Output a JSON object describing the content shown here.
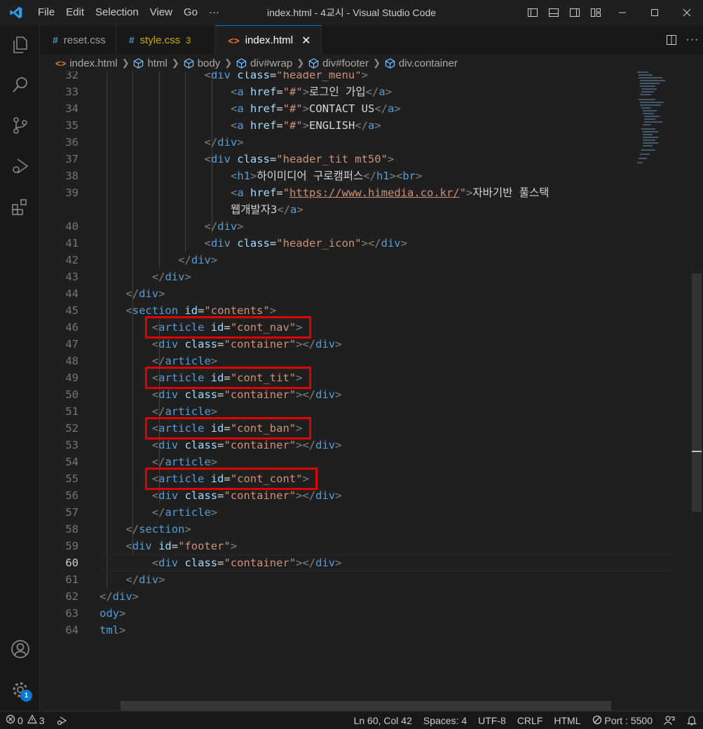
{
  "window": {
    "title": "index.html - 4교시 - Visual Studio Code",
    "menus": [
      "File",
      "Edit",
      "Selection",
      "View",
      "Go",
      "···"
    ]
  },
  "activity_bar": [
    "explorer-icon",
    "search-icon",
    "source-control-icon",
    "run-debug-icon",
    "extensions-icon",
    "account-icon",
    "settings-gear-icon"
  ],
  "settings_badge": "1",
  "tabs": [
    {
      "label": "reset.css",
      "icon": "#",
      "color": "#519aba",
      "active": false
    },
    {
      "label": "style.css",
      "icon": "#",
      "color": "#cca700",
      "modified_count": "3",
      "active": false
    },
    {
      "label": "index.html",
      "icon": "<>",
      "color": "#e37933",
      "active": true,
      "close": "✕"
    }
  ],
  "breadcrumb": [
    "index.html",
    "html",
    "body",
    "div#wrap",
    "div#footer",
    "div.container"
  ],
  "editor": {
    "current_line": 60,
    "lines": [
      {
        "n": "32",
        "indent": 4,
        "parts": [
          [
            "tg",
            "<"
          ],
          [
            "tn",
            "div "
          ],
          [
            "an",
            "class"
          ],
          [
            "eq",
            "="
          ],
          [
            "av",
            "\"header_menu\""
          ],
          [
            "tg",
            ">"
          ]
        ]
      },
      {
        "n": "33",
        "indent": 5,
        "parts": [
          [
            "tg",
            "<"
          ],
          [
            "tn",
            "a "
          ],
          [
            "an",
            "href"
          ],
          [
            "eq",
            "="
          ],
          [
            "av",
            "\"#\""
          ],
          [
            "tg",
            ">"
          ],
          [
            "tx",
            "로그인 가입"
          ],
          [
            "tg",
            "</"
          ],
          [
            "tn",
            "a"
          ],
          [
            "tg",
            ">"
          ]
        ]
      },
      {
        "n": "34",
        "indent": 5,
        "parts": [
          [
            "tg",
            "<"
          ],
          [
            "tn",
            "a "
          ],
          [
            "an",
            "href"
          ],
          [
            "eq",
            "="
          ],
          [
            "av",
            "\"#\""
          ],
          [
            "tg",
            ">"
          ],
          [
            "tx",
            "CONTACT US"
          ],
          [
            "tg",
            "</"
          ],
          [
            "tn",
            "a"
          ],
          [
            "tg",
            ">"
          ]
        ]
      },
      {
        "n": "35",
        "indent": 5,
        "parts": [
          [
            "tg",
            "<"
          ],
          [
            "tn",
            "a "
          ],
          [
            "an",
            "href"
          ],
          [
            "eq",
            "="
          ],
          [
            "av",
            "\"#\""
          ],
          [
            "tg",
            ">"
          ],
          [
            "tx",
            "ENGLISH"
          ],
          [
            "tg",
            "</"
          ],
          [
            "tn",
            "a"
          ],
          [
            "tg",
            ">"
          ]
        ]
      },
      {
        "n": "36",
        "indent": 4,
        "parts": [
          [
            "tg",
            "</"
          ],
          [
            "tn",
            "div"
          ],
          [
            "tg",
            ">"
          ]
        ]
      },
      {
        "n": "37",
        "indent": 4,
        "parts": [
          [
            "tg",
            "<"
          ],
          [
            "tn",
            "div "
          ],
          [
            "an",
            "class"
          ],
          [
            "eq",
            "="
          ],
          [
            "av",
            "\"header_tit mt50\""
          ],
          [
            "tg",
            ">"
          ]
        ]
      },
      {
        "n": "38",
        "indent": 5,
        "parts": [
          [
            "tg",
            "<"
          ],
          [
            "tn",
            "h1"
          ],
          [
            "tg",
            ">"
          ],
          [
            "tx",
            "하이미디어 구로캠퍼스"
          ],
          [
            "tg",
            "</"
          ],
          [
            "tn",
            "h1"
          ],
          [
            "tg",
            "><"
          ],
          [
            "tn",
            "br"
          ],
          [
            "tg",
            ">"
          ]
        ]
      },
      {
        "n": "39",
        "indent": 5,
        "parts": [
          [
            "tg",
            "<"
          ],
          [
            "tn",
            "a "
          ],
          [
            "an",
            "href"
          ],
          [
            "eq",
            "="
          ],
          [
            "av",
            "\""
          ],
          [
            "avu",
            "https://www.himedia.co.kr/"
          ],
          [
            "av",
            "\""
          ],
          [
            "tg",
            ">"
          ],
          [
            "tx",
            "자바기반 풀스택"
          ]
        ]
      },
      {
        "n": "",
        "indent": 5,
        "parts": [
          [
            "tx",
            "웹개발자3"
          ],
          [
            "tg",
            "</"
          ],
          [
            "tn",
            "a"
          ],
          [
            "tg",
            ">"
          ]
        ]
      },
      {
        "n": "40",
        "indent": 4,
        "parts": [
          [
            "tg",
            "</"
          ],
          [
            "tn",
            "div"
          ],
          [
            "tg",
            ">"
          ]
        ]
      },
      {
        "n": "41",
        "indent": 4,
        "parts": [
          [
            "tg",
            "<"
          ],
          [
            "tn",
            "div "
          ],
          [
            "an",
            "class"
          ],
          [
            "eq",
            "="
          ],
          [
            "av",
            "\"header_icon\""
          ],
          [
            "tg",
            "></"
          ],
          [
            "tn",
            "div"
          ],
          [
            "tg",
            ">"
          ]
        ]
      },
      {
        "n": "42",
        "indent": 3,
        "parts": [
          [
            "tg",
            "</"
          ],
          [
            "tn",
            "div"
          ],
          [
            "tg",
            ">"
          ]
        ]
      },
      {
        "n": "43",
        "indent": 2,
        "parts": [
          [
            "tg",
            "</"
          ],
          [
            "tn",
            "div"
          ],
          [
            "tg",
            ">"
          ]
        ]
      },
      {
        "n": "44",
        "indent": 1,
        "parts": [
          [
            "tg",
            "</"
          ],
          [
            "tn",
            "div"
          ],
          [
            "tg",
            ">"
          ]
        ]
      },
      {
        "n": "45",
        "indent": 1,
        "parts": [
          [
            "tg",
            "<"
          ],
          [
            "tn",
            "section "
          ],
          [
            "an",
            "id"
          ],
          [
            "eq",
            "="
          ],
          [
            "av",
            "\"contents\""
          ],
          [
            "tg",
            ">"
          ]
        ]
      },
      {
        "n": "46",
        "indent": 2,
        "parts": [
          [
            "tg",
            "<"
          ],
          [
            "tn",
            "article "
          ],
          [
            "an",
            "id"
          ],
          [
            "eq",
            "="
          ],
          [
            "av",
            "\"cont_nav\""
          ],
          [
            "tg",
            ">"
          ]
        ]
      },
      {
        "n": "47",
        "indent": 2,
        "parts": [
          [
            "tg",
            "<"
          ],
          [
            "tn",
            "div "
          ],
          [
            "an",
            "class"
          ],
          [
            "eq",
            "="
          ],
          [
            "av",
            "\"container\""
          ],
          [
            "tg",
            "></"
          ],
          [
            "tn",
            "div"
          ],
          [
            "tg",
            ">"
          ]
        ]
      },
      {
        "n": "48",
        "indent": 2,
        "parts": [
          [
            "tg",
            "</"
          ],
          [
            "tn",
            "article"
          ],
          [
            "tg",
            ">"
          ]
        ]
      },
      {
        "n": "49",
        "indent": 2,
        "parts": [
          [
            "tg",
            "<"
          ],
          [
            "tn",
            "article "
          ],
          [
            "an",
            "id"
          ],
          [
            "eq",
            "="
          ],
          [
            "av",
            "\"cont_tit\""
          ],
          [
            "tg",
            ">"
          ]
        ]
      },
      {
        "n": "50",
        "indent": 2,
        "parts": [
          [
            "tg",
            "<"
          ],
          [
            "tn",
            "div "
          ],
          [
            "an",
            "class"
          ],
          [
            "eq",
            "="
          ],
          [
            "av",
            "\"container\""
          ],
          [
            "tg",
            "></"
          ],
          [
            "tn",
            "div"
          ],
          [
            "tg",
            ">"
          ]
        ]
      },
      {
        "n": "51",
        "indent": 2,
        "parts": [
          [
            "tg",
            "</"
          ],
          [
            "tn",
            "article"
          ],
          [
            "tg",
            ">"
          ]
        ]
      },
      {
        "n": "52",
        "indent": 2,
        "parts": [
          [
            "tg",
            "<"
          ],
          [
            "tn",
            "article "
          ],
          [
            "an",
            "id"
          ],
          [
            "eq",
            "="
          ],
          [
            "av",
            "\"cont_ban\""
          ],
          [
            "tg",
            ">"
          ]
        ]
      },
      {
        "n": "53",
        "indent": 2,
        "parts": [
          [
            "tg",
            "<"
          ],
          [
            "tn",
            "div "
          ],
          [
            "an",
            "class"
          ],
          [
            "eq",
            "="
          ],
          [
            "av",
            "\"container\""
          ],
          [
            "tg",
            "></"
          ],
          [
            "tn",
            "div"
          ],
          [
            "tg",
            ">"
          ]
        ]
      },
      {
        "n": "54",
        "indent": 2,
        "parts": [
          [
            "tg",
            "</"
          ],
          [
            "tn",
            "article"
          ],
          [
            "tg",
            ">"
          ]
        ]
      },
      {
        "n": "55",
        "indent": 2,
        "parts": [
          [
            "tg",
            "<"
          ],
          [
            "tn",
            "article "
          ],
          [
            "an",
            "id"
          ],
          [
            "eq",
            "="
          ],
          [
            "av",
            "\"cont_cont\""
          ],
          [
            "tg",
            ">"
          ]
        ]
      },
      {
        "n": "56",
        "indent": 2,
        "parts": [
          [
            "tg",
            "<"
          ],
          [
            "tn",
            "div "
          ],
          [
            "an",
            "class"
          ],
          [
            "eq",
            "="
          ],
          [
            "av",
            "\"container\""
          ],
          [
            "tg",
            "></"
          ],
          [
            "tn",
            "div"
          ],
          [
            "tg",
            ">"
          ]
        ]
      },
      {
        "n": "57",
        "indent": 2,
        "parts": [
          [
            "tg",
            "</"
          ],
          [
            "tn",
            "article"
          ],
          [
            "tg",
            ">"
          ]
        ]
      },
      {
        "n": "58",
        "indent": 1,
        "parts": [
          [
            "tg",
            "</"
          ],
          [
            "tn",
            "section"
          ],
          [
            "tg",
            ">"
          ]
        ]
      },
      {
        "n": "59",
        "indent": 1,
        "parts": [
          [
            "tg",
            "<"
          ],
          [
            "tn",
            "div "
          ],
          [
            "an",
            "id"
          ],
          [
            "eq",
            "="
          ],
          [
            "av",
            "\"footer\""
          ],
          [
            "tg",
            ">"
          ]
        ]
      },
      {
        "n": "60",
        "indent": 2,
        "parts": [
          [
            "tg",
            "<"
          ],
          [
            "tn",
            "div "
          ],
          [
            "an",
            "class"
          ],
          [
            "eq",
            "="
          ],
          [
            "av",
            "\"container\""
          ],
          [
            "tg",
            "></"
          ],
          [
            "tn",
            "div"
          ],
          [
            "tg",
            ">"
          ]
        ]
      },
      {
        "n": "61",
        "indent": 1,
        "parts": [
          [
            "tg",
            "</"
          ],
          [
            "tn",
            "div"
          ],
          [
            "tg",
            ">"
          ]
        ]
      },
      {
        "n": "62",
        "indent": 0,
        "parts": [
          [
            "tg",
            "</"
          ],
          [
            "tn",
            "div"
          ],
          [
            "tg",
            ">"
          ]
        ]
      },
      {
        "n": "63",
        "indent": -1,
        "parts": [
          [
            "tn",
            "ody"
          ],
          [
            "tg",
            ">"
          ]
        ]
      },
      {
        "n": "64",
        "indent": -1,
        "parts": [
          [
            "tn",
            "tml"
          ],
          [
            "tg",
            ">"
          ]
        ]
      }
    ]
  },
  "highlights": [
    "cont_nav",
    "cont_tit",
    "cont_ban",
    "cont_cont"
  ],
  "status": {
    "errors": "0",
    "warnings": "3",
    "position": "Ln 60, Col 42",
    "spaces": "Spaces: 4",
    "encoding": "UTF-8",
    "eol": "CRLF",
    "language": "HTML",
    "port": "Port : 5500"
  },
  "colors": {
    "accent": "#0078d4",
    "highlight_box": "#e00000"
  }
}
